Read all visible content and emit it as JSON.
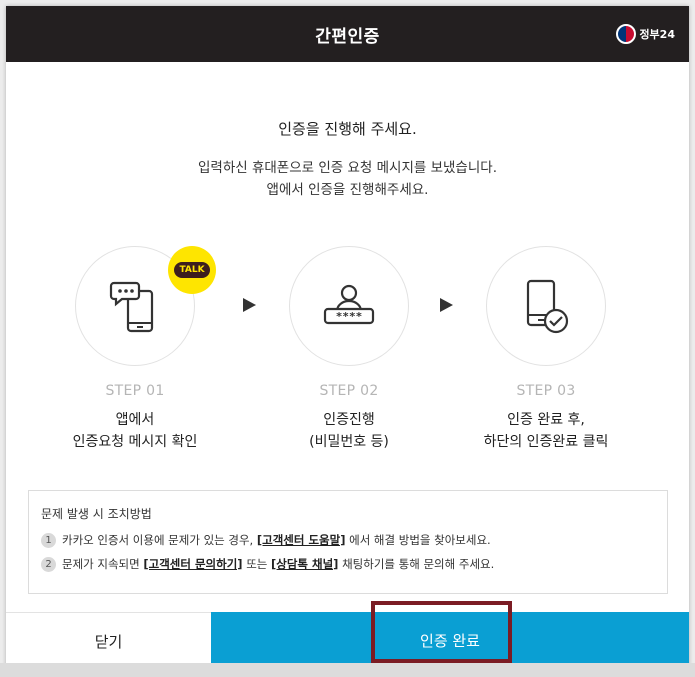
{
  "header": {
    "title": "간편인증",
    "logo_text": "정부24"
  },
  "intro": {
    "title": "인증을 진행해 주세요.",
    "line1": "입력하신 휴대폰으로 인증 요청 메시지를 보냈습니다.",
    "line2": "앱에서 인증을 진행해주세요."
  },
  "steps": [
    {
      "label": "STEP 01",
      "desc1": "앱에서",
      "desc2": "인증요청 메시지 확인",
      "icon": "phone-chat-icon"
    },
    {
      "label": "STEP 02",
      "desc1": "인증진행",
      "desc2": "(비밀번호 등)",
      "icon": "user-password-icon"
    },
    {
      "label": "STEP 03",
      "desc1": "인증 완료 후,",
      "desc2": "하단의 인증완료 클릭",
      "icon": "phone-check-icon"
    }
  ],
  "talk_badge": "TALK",
  "help": {
    "title": "문제 발생 시 조치방법",
    "items": [
      {
        "num": "1",
        "before": "카카오 인증서 이용에 문제가 있는 경우,",
        "link": "[고객센터 도움말]",
        "after": "에서 해결 방법을 찾아보세요."
      },
      {
        "num": "2",
        "before": "문제가 지속되면",
        "link": "[고객센터 문의하기]",
        "middle": "또는",
        "link2": "[상담톡 채널]",
        "after": "채팅하기를 통해 문의해 주세요."
      }
    ]
  },
  "footer": {
    "close_label": "닫기",
    "confirm_label": "인증 완료"
  },
  "colors": {
    "header_bg": "#231f20",
    "confirm_bg": "#0a9fd3",
    "highlight_border": "#7b1c24",
    "kakao_yellow": "#fee500"
  }
}
